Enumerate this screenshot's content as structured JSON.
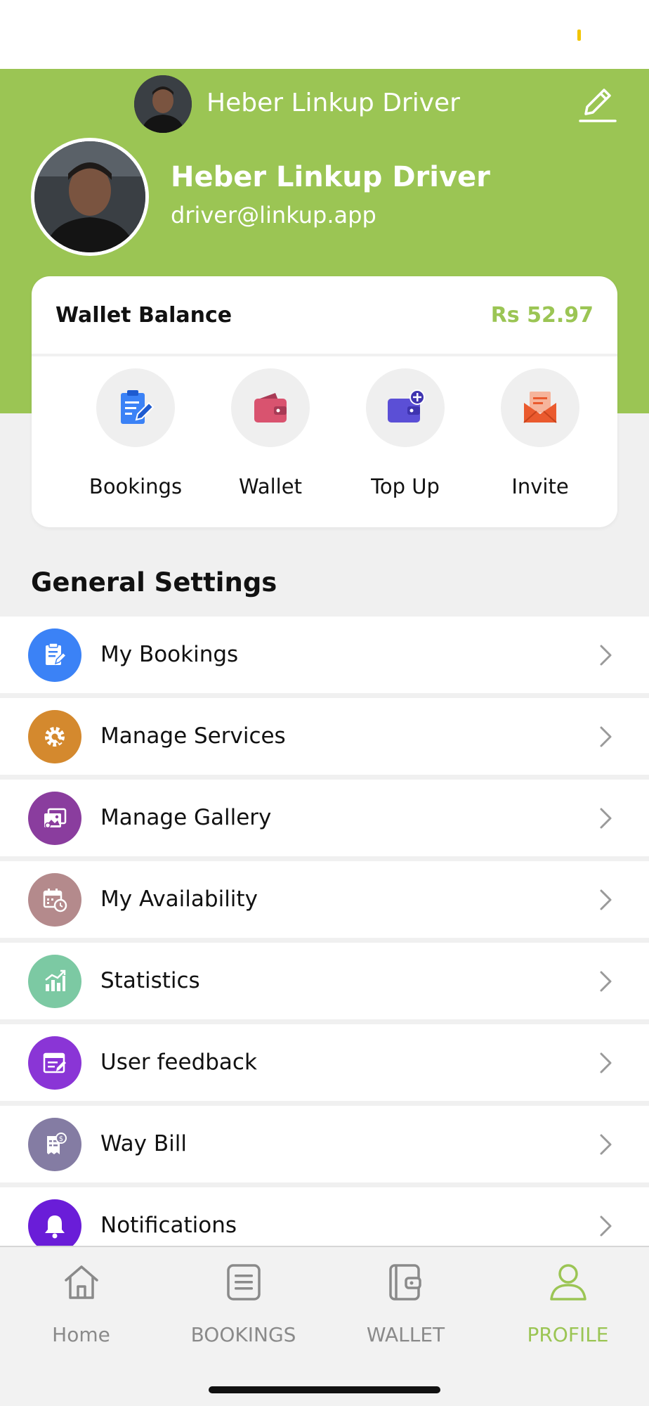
{
  "header": {
    "top_name": "Heber Linkup Driver",
    "profile_name": "Heber Linkup Driver",
    "profile_email": "driver@linkup.app",
    "accent_color": "#9bc554"
  },
  "wallet": {
    "title": "Wallet Balance",
    "amount": "Rs 52.97",
    "actions": [
      {
        "label": "Bookings",
        "icon": "clipboard-edit-icon",
        "color": "#3b82f6"
      },
      {
        "label": "Wallet",
        "icon": "wallet-icon",
        "color": "#d9536f"
      },
      {
        "label": "Top Up",
        "icon": "wallet-add-icon",
        "color": "#5b4fd6"
      },
      {
        "label": "Invite",
        "icon": "mail-open-icon",
        "color": "#ea5a2e"
      }
    ]
  },
  "settings": {
    "title": "General Settings",
    "items": [
      {
        "label": "My Bookings",
        "icon": "clipboard-edit-icon",
        "color": "#3b82f6"
      },
      {
        "label": "Manage Services",
        "icon": "gear-wrench-icon",
        "color": "#d4892e"
      },
      {
        "label": "Manage Gallery",
        "icon": "gallery-icon",
        "color": "#8a3d9e"
      },
      {
        "label": "My Availability",
        "icon": "calendar-clock-icon",
        "color": "#b48a8c"
      },
      {
        "label": "Statistics",
        "icon": "bar-chart-icon",
        "color": "#7cc9a3"
      },
      {
        "label": "User feedback",
        "icon": "feedback-form-icon",
        "color": "#8a35d6"
      },
      {
        "label": "Way Bill",
        "icon": "receipt-icon",
        "color": "#847ca3"
      },
      {
        "label": "Notifications",
        "icon": "bell-icon",
        "color": "#6a1dd8"
      }
    ]
  },
  "nav": {
    "items": [
      {
        "label": "Home",
        "icon": "home-icon",
        "active": false
      },
      {
        "label": "BOOKINGS",
        "icon": "list-icon",
        "active": false
      },
      {
        "label": "WALLET",
        "icon": "wallet-icon",
        "active": false
      },
      {
        "label": "PROFILE",
        "icon": "person-icon",
        "active": true
      }
    ]
  }
}
